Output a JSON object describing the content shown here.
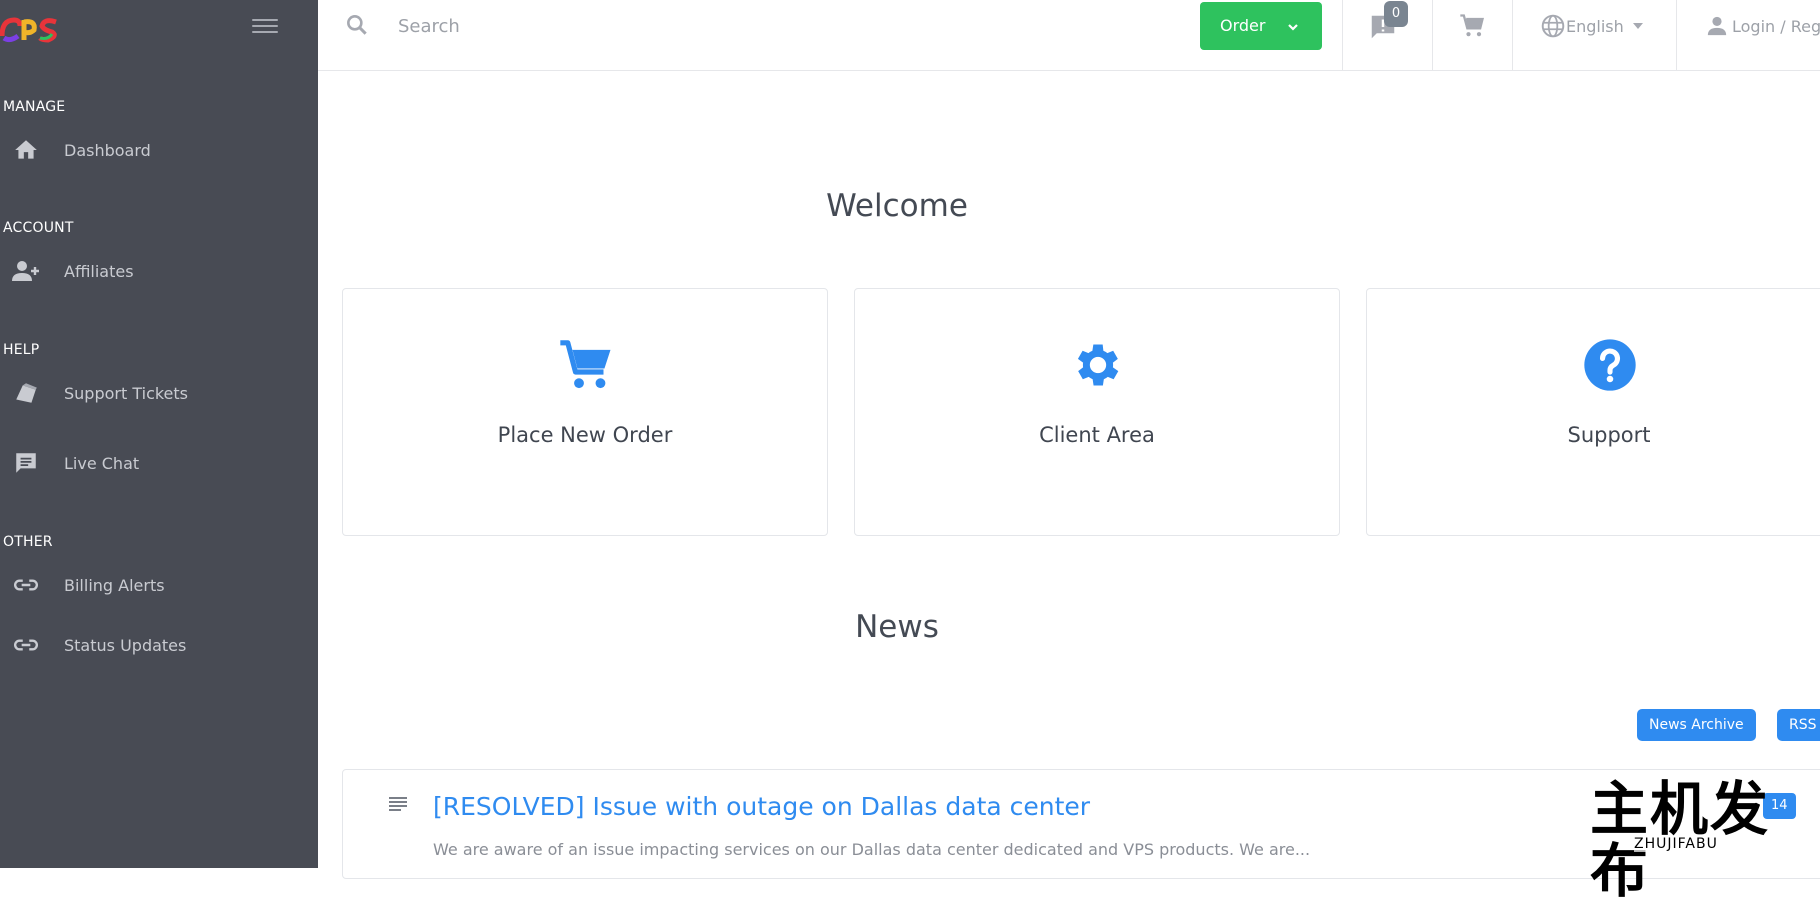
{
  "sidebar": {
    "sections": [
      {
        "label": "MANAGE"
      },
      {
        "label": "ACCOUNT"
      },
      {
        "label": "HELP"
      },
      {
        "label": "OTHER"
      }
    ],
    "items": [
      {
        "label": "Dashboard",
        "icon": "home-icon"
      },
      {
        "label": "Affiliates",
        "icon": "add-user-icon"
      },
      {
        "label": "Support Tickets",
        "icon": "ticket-icon"
      },
      {
        "label": "Live Chat",
        "icon": "chat-icon"
      },
      {
        "label": "Billing Alerts",
        "icon": "link-icon"
      },
      {
        "label": "Status Updates",
        "icon": "link-icon"
      }
    ]
  },
  "header": {
    "search_placeholder": "Search",
    "order_label": "Order",
    "notifications_count": "0",
    "language_label": "English",
    "login_label": "Login / Register"
  },
  "main": {
    "welcome_title": "Welcome",
    "cards": [
      {
        "label": "Place New Order",
        "icon": "cart-icon"
      },
      {
        "label": "Client Area",
        "icon": "gear-icon"
      },
      {
        "label": "Support",
        "icon": "question-icon"
      }
    ],
    "news_title": "News",
    "news_archive_label": "News Archive",
    "rss_label": "RSS",
    "news": [
      {
        "title": "[RESOLVED] Issue with outage on Dallas data center",
        "excerpt": "We are aware of an issue impacting services on our Dallas data center dedicated and VPS products. We are...",
        "date": "14"
      }
    ]
  },
  "watermark": {
    "text": "主机发布",
    "subtext": "ZHUJIFABU"
  },
  "colors": {
    "sidebar_bg": "#484b54",
    "order_green": "#2ec25e",
    "accent_blue": "#2f8bf0"
  }
}
